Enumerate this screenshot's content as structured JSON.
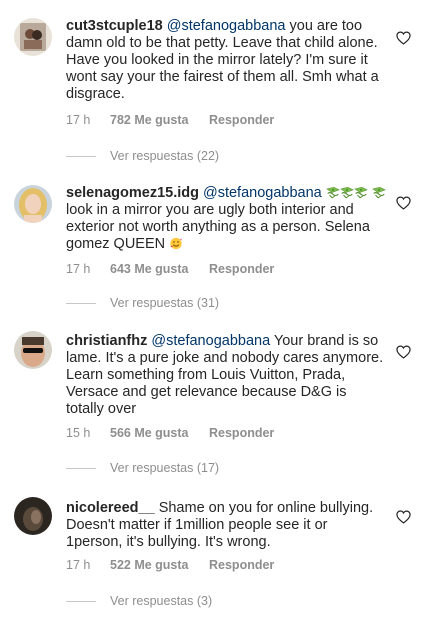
{
  "comments": [
    {
      "username": "cut3stcuple18",
      "mention": "@stefanogabbana",
      "text": " you are too damn old to be that petty. Leave that child alone. Have you looked in the mirror lately?  I'm sure it wont say your the fairest of them all.  Smh what a disgrace.",
      "time": "17 h",
      "likes": "782 Me gusta",
      "reply": "Responder",
      "view_replies": "Ver respuestas (22)"
    },
    {
      "username": "selenagomez15.idg",
      "mention": "@stefanogabbana",
      "text_after_emoji": " look in a mirror you are ugly both interior and exterior not worth anything as a person.  Selena gomez QUEEN ",
      "time": "17 h",
      "likes": "643 Me gusta",
      "reply": "Responder",
      "view_replies": "Ver respuestas (31)"
    },
    {
      "username": "christianfhz",
      "mention": "@stefanogabbana",
      "text": " Your brand is so lame. It's a pure joke and nobody cares anymore. Learn something from Louis Vuitton, Prada, Versace and get relevance because D&G is totally over",
      "time": "15 h",
      "likes": "566 Me gusta",
      "reply": "Responder",
      "view_replies": "Ver respuestas (17)"
    },
    {
      "username": "nicolereed__",
      "text": " Shame on you for online bullying. Doesn't matter if 1million people see it or 1person, it's bullying. It's wrong.",
      "time": "17 h",
      "likes": "522 Me gusta",
      "reply": "Responder",
      "view_replies": "Ver respuestas (3)"
    }
  ],
  "icons": {
    "like": "heart-outline-icon",
    "money": "money-with-wings-emoji",
    "face": "smiling-face-with-hearts-emoji"
  },
  "colors": {
    "text": "#262626",
    "muted": "#8e8e8e",
    "mention": "#003569"
  }
}
